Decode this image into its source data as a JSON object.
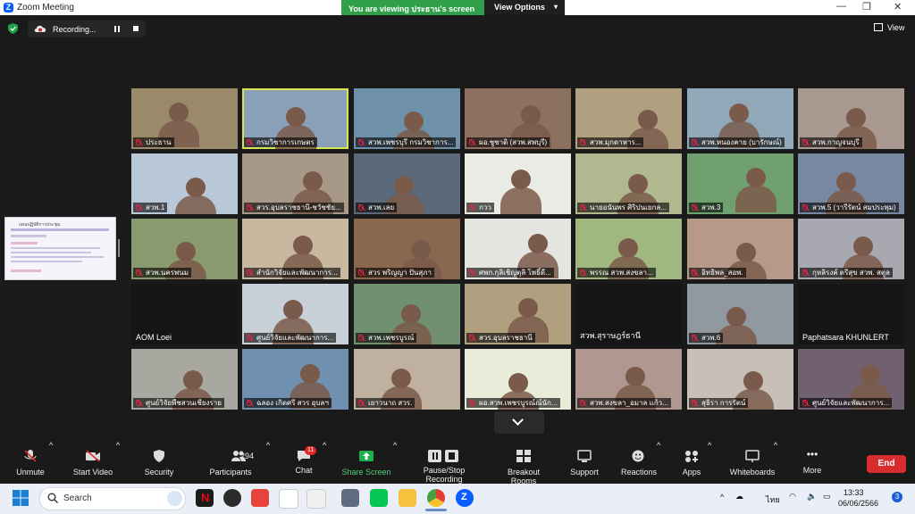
{
  "window": {
    "title": "Zoom Meeting",
    "logo": "Z",
    "controls": [
      "—",
      "❐",
      "✕"
    ]
  },
  "banner": {
    "message": "You are viewing ประธาน's screen",
    "view_options": "View Options"
  },
  "recording": {
    "label": "Recording..."
  },
  "view_button": "View",
  "shared_screen": {
    "heading": "แผนปฏิบัติการประชุม"
  },
  "tiles": [
    {
      "name": "ประธาน",
      "bg": "#9a8a6a"
    },
    {
      "name": "กรมวิชาการเกษตร",
      "bg": "#8aa0b8",
      "active": true
    },
    {
      "name": "สวพ.เพชรบุรี กรมวิชาการ...",
      "bg": "#6e90a8"
    },
    {
      "name": "ผอ.ชูชาติ (สวพ.สพบุรี)",
      "bg": "#8c7060"
    },
    {
      "name": "สวพ.มุกดาหาร...",
      "bg": "#b0a080"
    },
    {
      "name": "สวพ.หนองคาย (บารักษณ์)",
      "bg": "#90a8b8"
    },
    {
      "name": "สวพ.กาญจนบุรี",
      "bg": "#a89890"
    },
    {
      "name": "สวพ.1",
      "bg": "#b8c8d8"
    },
    {
      "name": "สวร.อุบลราชธานี-ชวัชชัย...",
      "bg": "#a89888"
    },
    {
      "name": "สวพ.เลย",
      "bg": "#5a6a7a"
    },
    {
      "name": "กวว",
      "bg": "#e8ece4"
    },
    {
      "name": "นายอนันพร ศิริปนเยกล...",
      "bg": "#b0b890"
    },
    {
      "name": "สวพ.3",
      "bg": "#70a070"
    },
    {
      "name": "สวพ.5 (วารีรัตน์ สมประพุม)",
      "bg": "#7888a0"
    },
    {
      "name": "สวพ.นครพนม",
      "bg": "#8a9a70"
    },
    {
      "name": "สำนักวิจัยและพัฒนาการ...",
      "bg": "#c8b8a0"
    },
    {
      "name": "สวร พริญญา ปันสุภา",
      "bg": "#8a6850"
    },
    {
      "name": "ศพก.กุลิเชิญตุลิ โพธิ์ดี...",
      "bg": "#e4e4e0"
    },
    {
      "name": "พรรณ สวพ.สงขลา...",
      "bg": "#a0b880"
    },
    {
      "name": "อิทธิพล_สอพ.",
      "bg": "#b89888"
    },
    {
      "name": "กุหลิรงค์ ตรีสุข สวพ. สตูล",
      "bg": "#a8a8b0"
    },
    {
      "name": "AOM Loei",
      "bg": "#151515",
      "plain": true
    },
    {
      "name": "ศูนย์วิจัยและพัฒนาการ...",
      "bg": "#c8d0d8"
    },
    {
      "name": "สวพ.เพชรบูรณ์",
      "bg": "#709070"
    },
    {
      "name": "สวร.อุบลราชธานี",
      "bg": "#b0a080"
    },
    {
      "name": "สวพ.สุราษฎร์ธานี",
      "bg": "#151515",
      "plain": true
    },
    {
      "name": "สวพ.6",
      "bg": "#9098a0"
    },
    {
      "name": "Paphatsara KHUNLERT",
      "bg": "#151515",
      "plain": true
    },
    {
      "name": "ศูนย์วิจัยพืชสวนเชียงราย",
      "bg": "#a8a8a0"
    },
    {
      "name": "ฉลอง เกิดศรี สวร อุบลฯ",
      "bg": "#7090b0"
    },
    {
      "name": "เยาวนาถ สวร.",
      "bg": "#c0b0a0"
    },
    {
      "name": "ผอ.สวพ.เพชรบูรณ์ณ์นัก...",
      "bg": "#e8ecd8"
    },
    {
      "name": "สวพ.สงขลา_อมาล แก้ว...",
      "bg": "#b09890"
    },
    {
      "name": "สุธิรา การรัตน์",
      "bg": "#c8c0b8"
    },
    {
      "name": "ศูนย์วิจัยและพัฒนาการ...",
      "bg": "#706070"
    }
  ],
  "toolbar": {
    "unmute": "Unmute",
    "start_video": "Start Video",
    "security": "Security",
    "participants": "Participants",
    "participant_count": "294",
    "chat": "Chat",
    "chat_badge": "11",
    "share_screen": "Share Screen",
    "pause_stop_recording": "Pause/Stop Recording",
    "breakout_rooms": "Breakout Rooms",
    "support": "Support",
    "reactions": "Reactions",
    "apps": "Apps",
    "whiteboards": "Whiteboards",
    "more": "More",
    "end": "End"
  },
  "taskbar": {
    "search_placeholder": "Search",
    "language": "ไทย",
    "time": "13:33",
    "date": "06/06/2566",
    "notification_count": "3"
  }
}
